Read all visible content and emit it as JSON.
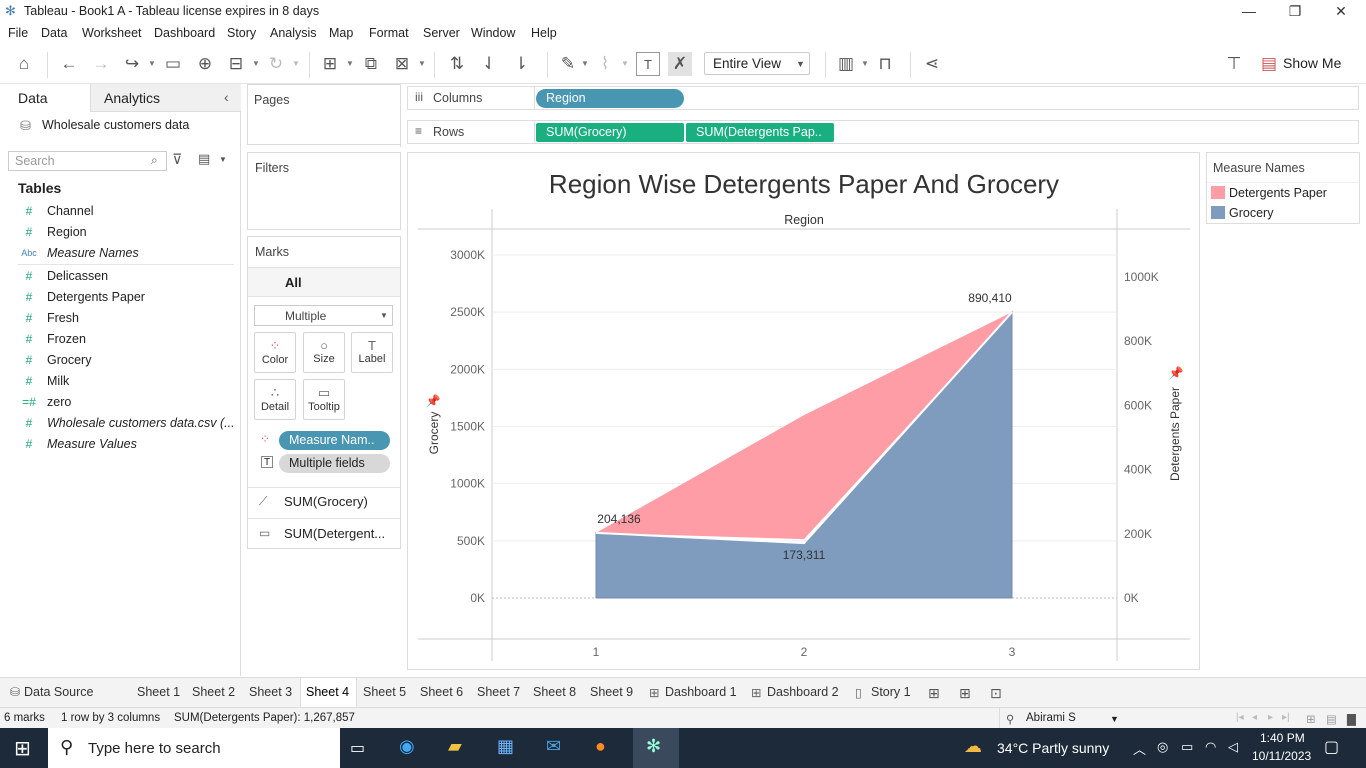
{
  "window": {
    "title": "Tableau - Book1 A - Tableau license expires in 8 days"
  },
  "menu": [
    "File",
    "Data",
    "Worksheet",
    "Dashboard",
    "Story",
    "Analysis",
    "Map",
    "Format",
    "Server",
    "Window",
    "Help"
  ],
  "toolbar": {
    "view_select": "Entire View",
    "show_me": "Show Me"
  },
  "left_pane": {
    "tabs": [
      "Data",
      "Analytics"
    ],
    "datasource": "Wholesale customers data",
    "search_placeholder": "Search",
    "tables_header": "Tables",
    "fields": [
      {
        "icon": "#",
        "name": "Channel",
        "italic": false
      },
      {
        "icon": "#",
        "name": "Region",
        "italic": false
      },
      {
        "icon": "Abc",
        "name": "Measure Names",
        "italic": true
      },
      {
        "icon": "#",
        "name": "Delicassen",
        "italic": false
      },
      {
        "icon": "#",
        "name": "Detergents Paper",
        "italic": false
      },
      {
        "icon": "#",
        "name": "Fresh",
        "italic": false
      },
      {
        "icon": "#",
        "name": "Frozen",
        "italic": false
      },
      {
        "icon": "#",
        "name": "Grocery",
        "italic": false
      },
      {
        "icon": "#",
        "name": "Milk",
        "italic": false
      },
      {
        "icon": "=#",
        "name": "zero",
        "italic": false
      },
      {
        "icon": "#",
        "name": "Wholesale customers data.csv (...",
        "italic": true
      },
      {
        "icon": "#",
        "name": "Measure Values",
        "italic": true
      }
    ]
  },
  "cards": {
    "pages": "Pages",
    "filters": "Filters",
    "marks": {
      "title": "Marks",
      "all": "All",
      "type": "Multiple",
      "buttons": [
        "Color",
        "Size",
        "Label",
        "Detail",
        "Tooltip"
      ],
      "pills": [
        "Measure Nam..",
        "Multiple fields"
      ],
      "sub": [
        "SUM(Grocery)",
        "SUM(Detergent..."
      ]
    }
  },
  "shelves": {
    "columns_label": "Columns",
    "rows_label": "Rows",
    "columns": [
      "Region"
    ],
    "rows": [
      "SUM(Grocery)",
      "SUM(Detergents Pap.."
    ]
  },
  "legend": {
    "title": "Measure Names",
    "items": [
      {
        "name": "Detergents Paper",
        "color": "#ff9da7"
      },
      {
        "name": "Grocery",
        "color": "#7f9cbe"
      }
    ]
  },
  "chart_data": {
    "type": "area",
    "title": "Region Wise Detergents Paper And Grocery",
    "xlabel": "Region",
    "x": [
      1,
      2,
      3
    ],
    "x_tick_labels": [
      "1",
      "2",
      "3"
    ],
    "ylabel": "Grocery",
    "ylabel_right": "Detergents Paper",
    "ylim": [
      0,
      3000000
    ],
    "ylim_right": [
      0,
      1000000
    ],
    "y_ticks": [
      "0K",
      "500K",
      "1000K",
      "1500K",
      "2000K",
      "2500K",
      "3000K"
    ],
    "y_ticks_right": [
      "0K",
      "200K",
      "400K",
      "600K",
      "800K",
      "1000K"
    ],
    "series": [
      {
        "name": "Grocery",
        "axis": "left",
        "values": [
          570000,
          480000,
          2500000
        ],
        "color": "#7f9cbe"
      },
      {
        "name": "Detergents Paper",
        "axis": "right",
        "values": [
          204136,
          173311,
          890410
        ],
        "color": "#ff9da7"
      }
    ],
    "data_labels": [
      "204,136",
      "173,311",
      "890,410"
    ],
    "grid": true
  },
  "sheets": [
    "Data Source",
    "Sheet 1",
    "Sheet 2",
    "Sheet 3",
    "Sheet 4",
    "Sheet 5",
    "Sheet 6",
    "Sheet 7",
    "Sheet 8",
    "Sheet 9",
    "Dashboard 1",
    "Dashboard 2",
    "Story 1"
  ],
  "active_sheet": "Sheet 4",
  "status": {
    "marks": "6 marks",
    "layout": "1 row by 3 columns",
    "sum": "SUM(Detergents Paper): 1,267,857",
    "user": "Abirami S"
  },
  "taskbar": {
    "search": "Type here to search",
    "weather": "34°C  Partly sunny",
    "time": "1:40 PM",
    "date": "10/11/2023"
  }
}
